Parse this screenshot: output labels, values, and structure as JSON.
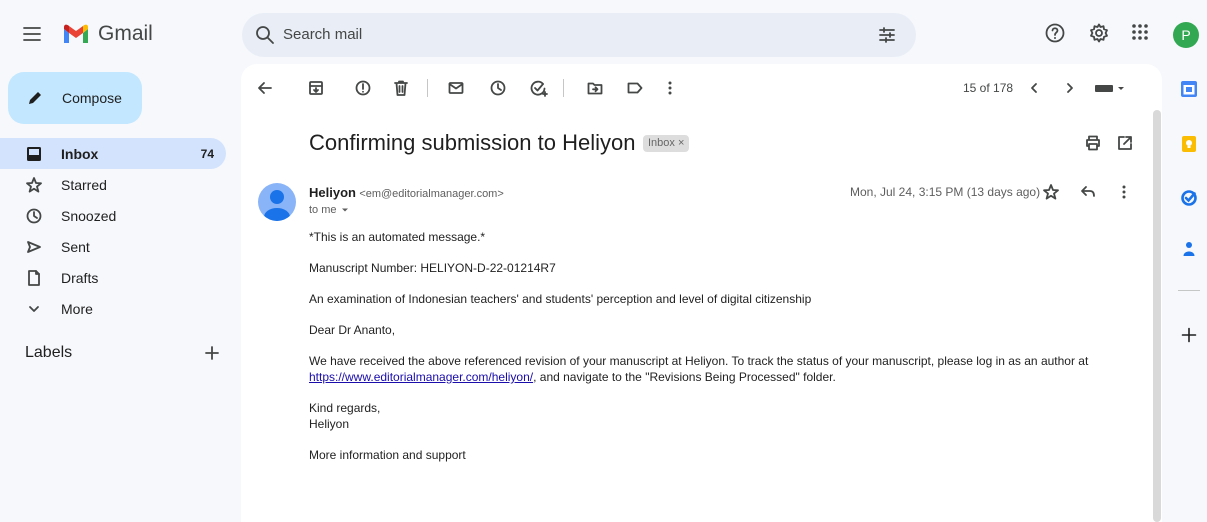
{
  "app": {
    "name": "Gmail"
  },
  "search": {
    "placeholder": "Search mail"
  },
  "account": {
    "initial": "P"
  },
  "compose": {
    "label": "Compose"
  },
  "nav": [
    {
      "label": "Inbox",
      "count": "74",
      "icon": "inbox-icon"
    },
    {
      "label": "Starred",
      "count": "",
      "icon": "star-icon"
    },
    {
      "label": "Snoozed",
      "count": "",
      "icon": "clock-icon"
    },
    {
      "label": "Sent",
      "count": "",
      "icon": "send-icon"
    },
    {
      "label": "Drafts",
      "count": "",
      "icon": "draft-icon"
    },
    {
      "label": "More",
      "count": "",
      "icon": "chevron-down-icon"
    }
  ],
  "labels": {
    "title": "Labels"
  },
  "toolbar": {
    "pager": "15 of 178"
  },
  "message": {
    "subject": "Confirming submission to Heliyon",
    "tag": "Inbox",
    "sender_name": "Heliyon",
    "sender_email": "<em@editorialmanager.com>",
    "to": "to me",
    "date": "Mon, Jul 24, 3:15 PM (13 days ago)",
    "body": {
      "p1": "*This is an automated message.*",
      "p2": "Manuscript Number: HELIYON-D-22-01214R7",
      "p3": "An examination of Indonesian teachers' and students' perception and level of digital citizenship",
      "p4": "Dear Dr Ananto,",
      "p5a": "We have received the above referenced revision of your manuscript at Heliyon. To track the status of your manuscript, please log in as an author at ",
      "link": "https://www.editorialmanager.com/heliyon/",
      "p5b": ", and navigate to the \"Revisions Being Processed\" folder.",
      "p6a": "Kind regards,",
      "p6b": "Heliyon",
      "p7": "More information and support"
    }
  },
  "colors": {
    "accent": "#c2e7ff",
    "active_nav": "#d3e3fd",
    "background": "#f6f8fc",
    "avatar": "#33a852"
  }
}
